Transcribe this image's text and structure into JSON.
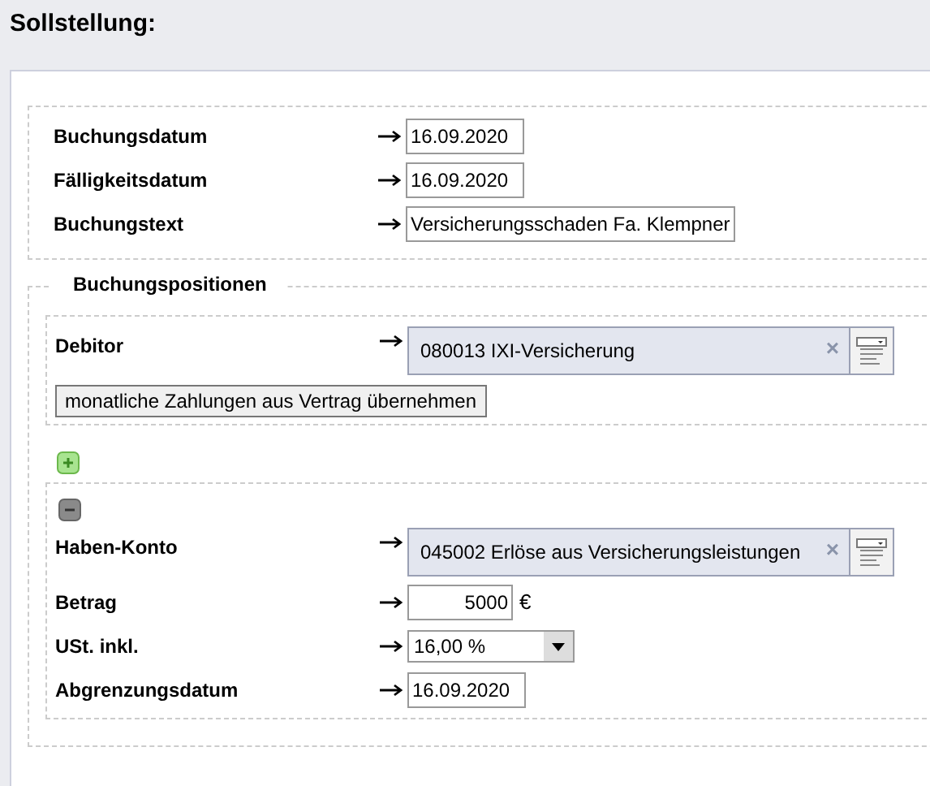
{
  "title": "Sollstellung:",
  "header_fields": [
    {
      "label": "Buchungsdatum",
      "kind": "date",
      "value": "16.09.2020"
    },
    {
      "label": "Fälligkeitsdatum",
      "kind": "date",
      "value": "16.09.2020"
    },
    {
      "label": "Buchungstext",
      "kind": "text",
      "value": "Versicherungsschaden Fa. Klempner"
    }
  ],
  "positions": {
    "legend": "Buchungspositionen",
    "debitor": {
      "fields": [
        {
          "label": "Debitor",
          "kind": "lookup",
          "value": "080013 IXI-Versicherung",
          "clear": "×"
        }
      ],
      "button": "monatliche Zahlungen aus Vertrag übernehmen"
    },
    "item": {
      "fields": [
        {
          "label": "Haben-Konto",
          "kind": "lookup",
          "value": "045002 Erlöse aus Versicherungsleistungen",
          "clear": "×"
        },
        {
          "label": "Betrag",
          "kind": "amount",
          "value": "5000",
          "unit": "€"
        },
        {
          "label": "USt. inkl.",
          "kind": "select",
          "value": "16,00 %"
        },
        {
          "label": "Abgrenzungsdatum",
          "kind": "date",
          "value": "16.09.2020"
        }
      ]
    }
  }
}
